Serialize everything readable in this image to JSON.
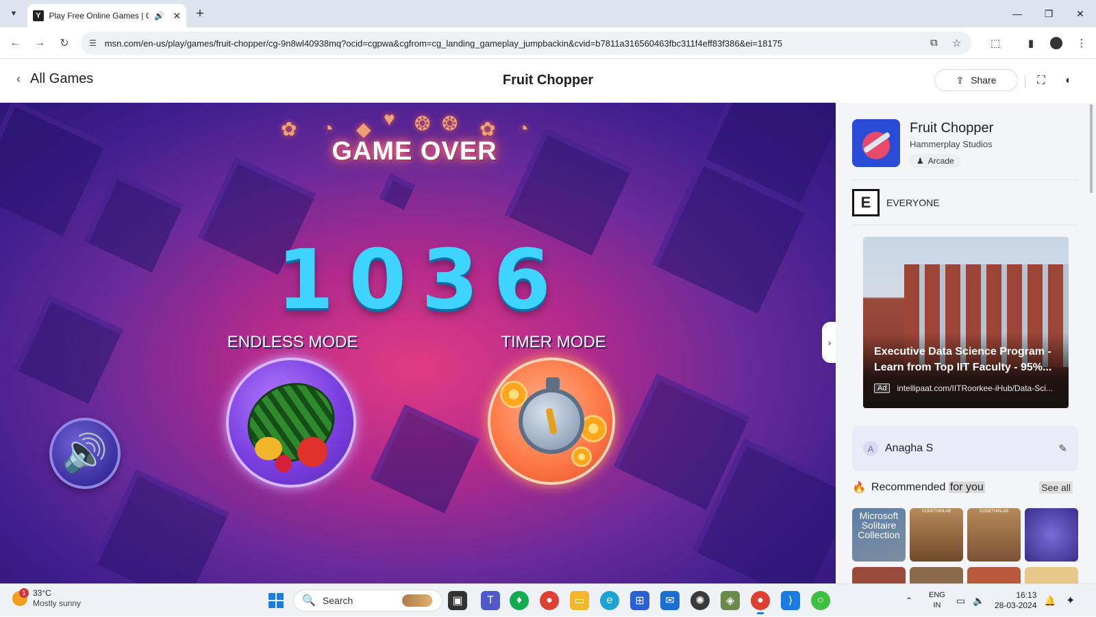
{
  "browser": {
    "tab_title": "Play Free Online Games | G",
    "tab_favicon": "Y",
    "url": "msn.com/en-us/play/games/fruit-chopper/cg-9n8wl40938mq?ocid=cgpwa&cgfrom=cg_landing_gameplay_jumpbackin&cvid=b7811a316560463fbc311f4eff83f386&ei=18175"
  },
  "header": {
    "back_label": "All Games",
    "title": "Fruit Chopper",
    "share_label": "Share"
  },
  "game": {
    "game_over": "GAME OVER",
    "score": "1036",
    "endless_label": "ENDLESS MODE",
    "timer_label": "TIMER MODE"
  },
  "side": {
    "game_name": "Fruit Chopper",
    "studio": "Hammerplay Studios",
    "genre": "Arcade",
    "rating": "EVERYONE",
    "esrb_badge": "E",
    "ad": {
      "title": "Executive Data Science Program - Learn from Top IIT Faculty - 95%...",
      "badge": "Ad",
      "url": "intellipaat.com/IITRoorkee-iHub/Data-Sci..."
    },
    "user": {
      "initial": "A",
      "name": "Anagha S"
    },
    "recommended": {
      "title_a": "Recommended ",
      "title_b": "for you",
      "see_all": "See all",
      "tiles": [
        {
          "caption": "Microsoft Solitaire Collection",
          "tag": ""
        },
        {
          "caption": "",
          "tag": "CODETHISLAB"
        },
        {
          "caption": "",
          "tag": "CODETHISLAB"
        },
        {
          "caption": "",
          "tag": ""
        }
      ]
    }
  },
  "taskbar": {
    "weather_badge": "1",
    "temperature": "33°C",
    "condition": "Mostly sunny",
    "search_label": "Search",
    "lang_top": "ENG",
    "lang_bottom": "IN",
    "time": "16:13",
    "date": "28-03-2024"
  },
  "colors": {
    "score": "#3fd3ff",
    "game_bg": "#6a2a9a",
    "accent": "#1a7be0"
  }
}
